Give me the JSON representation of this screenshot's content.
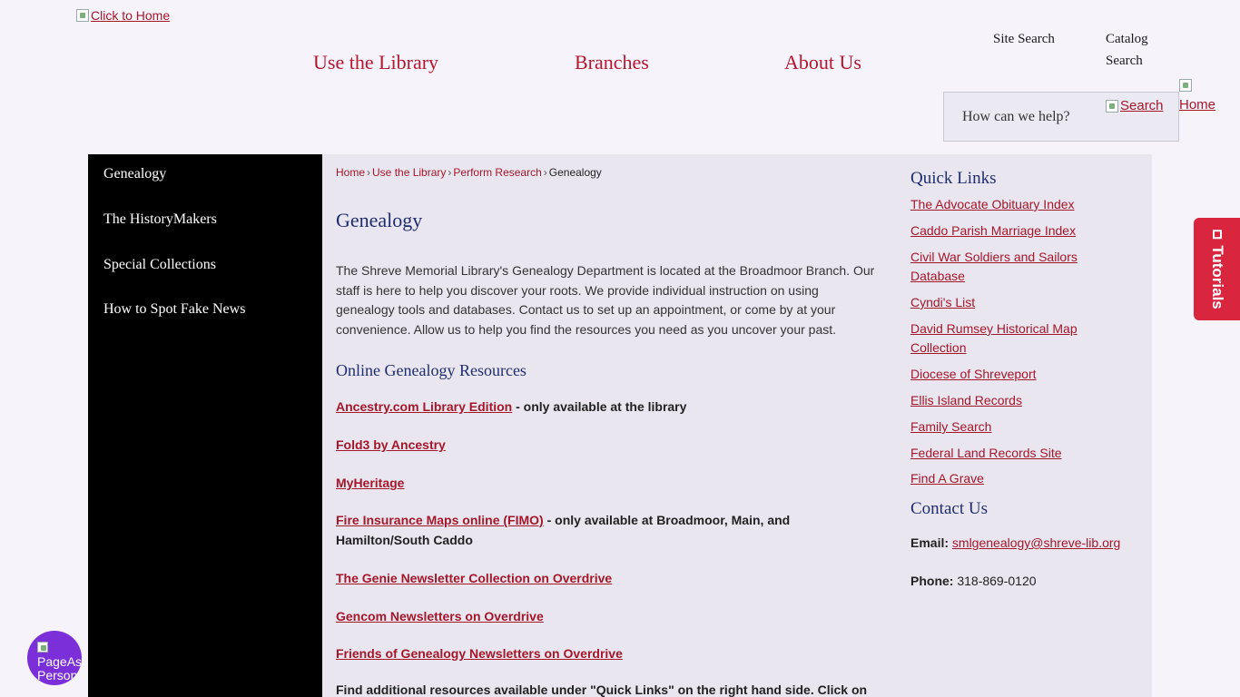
{
  "header": {
    "logo_alt": "Click to Home",
    "nav": [
      "Use the Library",
      "Branches",
      "About Us"
    ],
    "utility": {
      "site_search": "Site Search",
      "catalog_search": "Catalog Search"
    },
    "search": {
      "placeholder": "How can we help?",
      "button_alt": "Search"
    },
    "home_icon_alt": "Home"
  },
  "sidebar": {
    "items": [
      "Genealogy",
      "The HistoryMakers",
      "Special Collections",
      "How to Spot Fake News"
    ]
  },
  "breadcrumb": [
    "Home",
    "Use the Library",
    "Perform Research",
    "Genealogy"
  ],
  "main": {
    "title": "Genealogy",
    "intro": "The Shreve Memorial Library's Genealogy Department is located at the Broadmoor Branch. Our staff is here to help you discover your roots. We provide individual instruction on using genealogy tools and databases. Contact us to set up an appointment, or come by at your convenience. Allow us to help you find the resources you need as you uncover your past.",
    "resources_heading": "Online Genealogy Resources",
    "resources": [
      {
        "link": "Ancestry.com Library Edition",
        "note": " - only available at the library"
      },
      {
        "link": "Fold3 by Ancestry",
        "note": ""
      },
      {
        "link": "MyHeritage",
        "note": ""
      },
      {
        "link": "Fire Insurance Maps online (FIMO)",
        "note": " - only available at Broadmoor, Main, and Hamilton/South Caddo"
      },
      {
        "link": "The Genie Newsletter Collection on Overdrive",
        "note": ""
      },
      {
        "link": "Gencom Newsletters on Overdrive",
        "note": ""
      },
      {
        "link": "Friends of Genealogy Newsletters on Overdrive",
        "note": ""
      }
    ],
    "additional": "Find additional resources available under \"Quick Links\" on the right hand side. Click on"
  },
  "quick_links": {
    "heading": "Quick Links",
    "items": [
      "The Advocate Obituary Index",
      "Caddo Parish Marriage Index",
      "Civil War Soldiers and Sailors Database",
      "Cyndi's List",
      "David Rumsey Historical Map Collection",
      "Diocese of Shreveport",
      "Ellis Island Records",
      "Family Search",
      "Federal Land Records Site",
      "Find A Grave"
    ]
  },
  "contact": {
    "heading": "Contact Us",
    "email_label": "Email:",
    "email": "smlgenealogy@shreve-lib.org",
    "phone_label": "Phone:",
    "phone": "318-869-0120"
  },
  "tutorials": {
    "label": "Tutorials"
  },
  "widget": {
    "alt": "PageAssist Personalization"
  },
  "colors": {
    "accent_red": "#a4172a",
    "nav_red": "#b5172f",
    "heading_blue": "#1f2d6e",
    "tab_red": "#d9263e",
    "widget_purple": "#7b2fd8"
  }
}
